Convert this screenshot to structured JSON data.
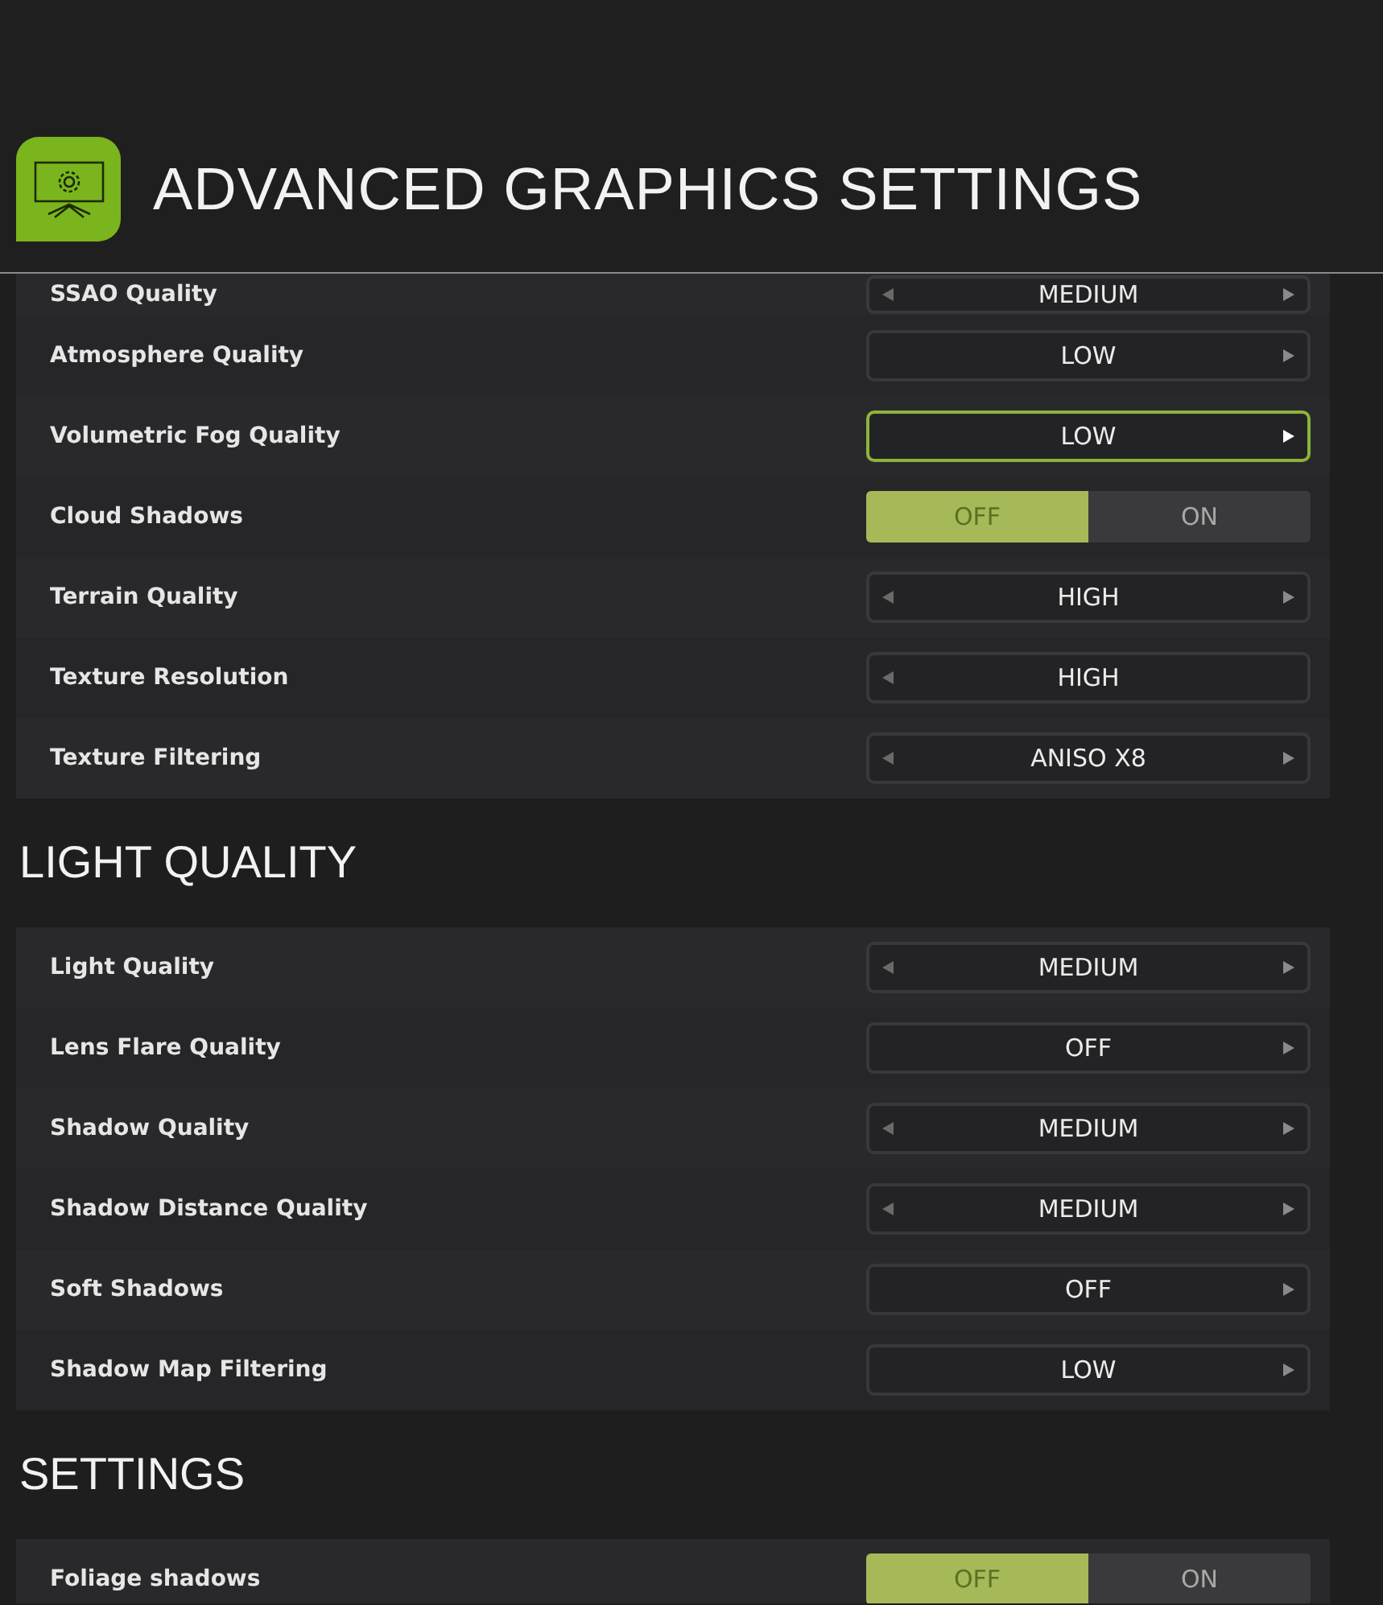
{
  "header": {
    "title": "ADVANCED GRAPHICS SETTINGS"
  },
  "sections": [
    {
      "rows": [
        {
          "label": "SSAO Quality",
          "kind": "selector",
          "value": "MEDIUM",
          "left_arrow": true,
          "right_arrow": true,
          "focused": false
        },
        {
          "label": "Atmosphere Quality",
          "kind": "selector",
          "value": "LOW",
          "left_arrow": false,
          "right_arrow": true,
          "focused": false
        },
        {
          "label": "Volumetric Fog Quality",
          "kind": "selector",
          "value": "LOW",
          "left_arrow": false,
          "right_arrow": true,
          "focused": true
        },
        {
          "label": "Cloud Shadows",
          "kind": "toggle",
          "options": [
            {
              "label": "OFF",
              "selected": true
            },
            {
              "label": "ON",
              "selected": false
            }
          ]
        },
        {
          "label": "Terrain Quality",
          "kind": "selector",
          "value": "HIGH",
          "left_arrow": true,
          "right_arrow": true,
          "focused": false
        },
        {
          "label": "Texture Resolution",
          "kind": "selector",
          "value": "HIGH",
          "left_arrow": true,
          "right_arrow": false,
          "focused": false
        },
        {
          "label": "Texture Filtering",
          "kind": "selector",
          "value": "ANISO X8",
          "left_arrow": true,
          "right_arrow": true,
          "focused": false
        }
      ]
    },
    {
      "title": "LIGHT QUALITY",
      "rows": [
        {
          "label": "Light Quality",
          "kind": "selector",
          "value": "MEDIUM",
          "left_arrow": true,
          "right_arrow": true,
          "focused": false
        },
        {
          "label": "Lens Flare Quality",
          "kind": "selector",
          "value": "OFF",
          "left_arrow": false,
          "right_arrow": true,
          "focused": false
        },
        {
          "label": "Shadow Quality",
          "kind": "selector",
          "value": "MEDIUM",
          "left_arrow": true,
          "right_arrow": true,
          "focused": false
        },
        {
          "label": "Shadow Distance Quality",
          "kind": "selector",
          "value": "MEDIUM",
          "left_arrow": true,
          "right_arrow": true,
          "focused": false
        },
        {
          "label": "Soft Shadows",
          "kind": "selector",
          "value": "OFF",
          "left_arrow": false,
          "right_arrow": true,
          "focused": false
        },
        {
          "label": "Shadow Map Filtering",
          "kind": "selector",
          "value": "LOW",
          "left_arrow": false,
          "right_arrow": true,
          "focused": false
        }
      ]
    },
    {
      "title": "SETTINGS",
      "rows": [
        {
          "label": "Foliage shadows",
          "kind": "toggle",
          "options": [
            {
              "label": "OFF",
              "selected": true
            },
            {
              "label": "ON",
              "selected": false
            }
          ]
        }
      ]
    }
  ]
}
